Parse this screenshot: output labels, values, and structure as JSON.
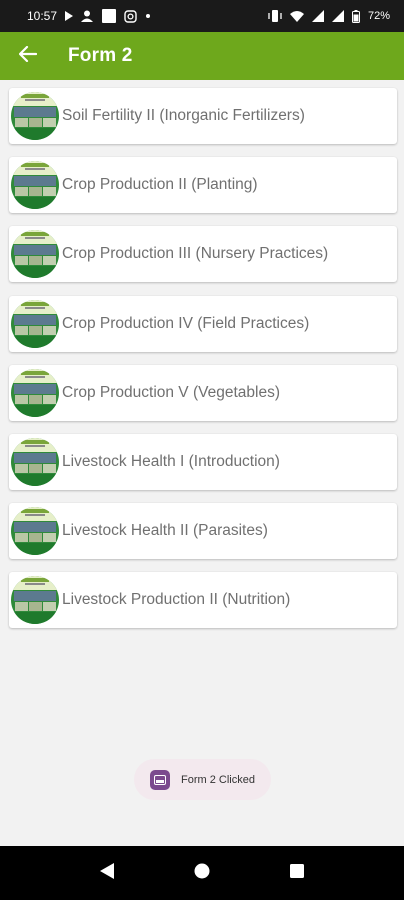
{
  "status_bar": {
    "time": "10:57",
    "battery": "72%",
    "icons": [
      "play-icon",
      "person-icon",
      "square-icon",
      "instagram-icon",
      "dot-icon",
      "vibrate-icon",
      "wifi-icon",
      "signal-icon",
      "battery-icon"
    ]
  },
  "app_bar": {
    "title": "Form 2",
    "back_icon": "arrow-back-icon",
    "color": "#6ea81c"
  },
  "items": [
    {
      "label": "Soil Fertility II (Inorganic Fertilizers)"
    },
    {
      "label": "Crop Production II (Planting)"
    },
    {
      "label": "Crop Production III (Nursery Practices)"
    },
    {
      "label": "Crop Production IV (Field Practices)"
    },
    {
      "label": "Crop Production V (Vegetables)"
    },
    {
      "label": "Livestock Health I (Introduction)"
    },
    {
      "label": "Livestock Health II (Parasites)"
    },
    {
      "label": "Livestock Production II (Nutrition)"
    }
  ],
  "toast": {
    "text": "Form 2 Clicked"
  },
  "nav_bar": {
    "buttons": [
      "back-triangle-icon",
      "home-circle-icon",
      "recents-square-icon"
    ]
  }
}
